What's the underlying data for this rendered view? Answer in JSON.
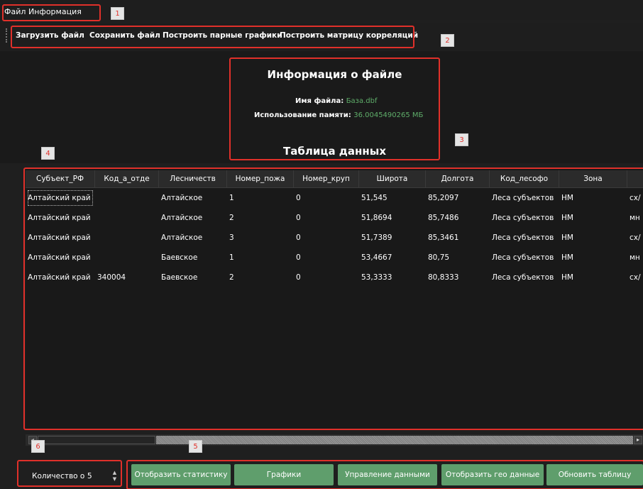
{
  "menubar": {
    "items": [
      {
        "label": "Файл"
      },
      {
        "label": "Информация"
      }
    ]
  },
  "toolbar": {
    "buttons": [
      {
        "label": "Загрузить файл"
      },
      {
        "label": "Сохранить файл"
      },
      {
        "label": "Построить парные графики"
      },
      {
        "label": "Построить матрицу корреляций"
      }
    ]
  },
  "info": {
    "title": "Информация о файле",
    "filename_label": "Имя файла:",
    "filename_value": "База.dbf",
    "memory_label": "Использование памяти:",
    "memory_value": "36.0045490265 МБ"
  },
  "table_title": "Таблица данных",
  "table": {
    "columns": [
      "Субъект_РФ",
      "Код_а_отде",
      "Лесничеств",
      "Номер_пожа",
      "Номер_круп",
      "Широта",
      "Долгота",
      "Код_лесофо",
      "Зона",
      ""
    ],
    "rows": [
      [
        "Алтайский край",
        "",
        "Алтайское",
        "1",
        "0",
        "51,545",
        "85,2097",
        "Леса субъектов",
        "НМ",
        "сх/"
      ],
      [
        "Алтайский край",
        "",
        "Алтайское",
        "2",
        "0",
        "51,8694",
        "85,7486",
        "Леса субъектов",
        "НМ",
        "мн"
      ],
      [
        "Алтайский край",
        "",
        "Алтайское",
        "3",
        "0",
        "51,7389",
        "85,3461",
        "Леса субъектов",
        "НМ",
        "сх/"
      ],
      [
        "Алтайский край",
        "",
        "Баевское",
        "1",
        "0",
        "53,4667",
        "80,75",
        "Леса субъектов",
        "НМ",
        "мн"
      ],
      [
        "Алтайский край",
        "340004",
        "Баевское",
        "2",
        "0",
        "53,3333",
        "80,8333",
        "Леса субъектов",
        "НМ",
        "сх/"
      ]
    ]
  },
  "bottom": {
    "count_label": "Количество о",
    "count_value": "5",
    "buttons": [
      {
        "label": "Отобразить статистику"
      },
      {
        "label": "Графики"
      },
      {
        "label": "Управление данными"
      },
      {
        "label": "Отобразить гео данные"
      },
      {
        "label": "Обновить таблицу"
      }
    ]
  },
  "annotations": [
    "1",
    "2",
    "3",
    "4",
    "5",
    "6"
  ],
  "colors": {
    "background": "#1f1f1f",
    "accent_green": "#5f9e6c",
    "annotation_red": "#e0302a",
    "info_value_green": "#5fae6a"
  }
}
